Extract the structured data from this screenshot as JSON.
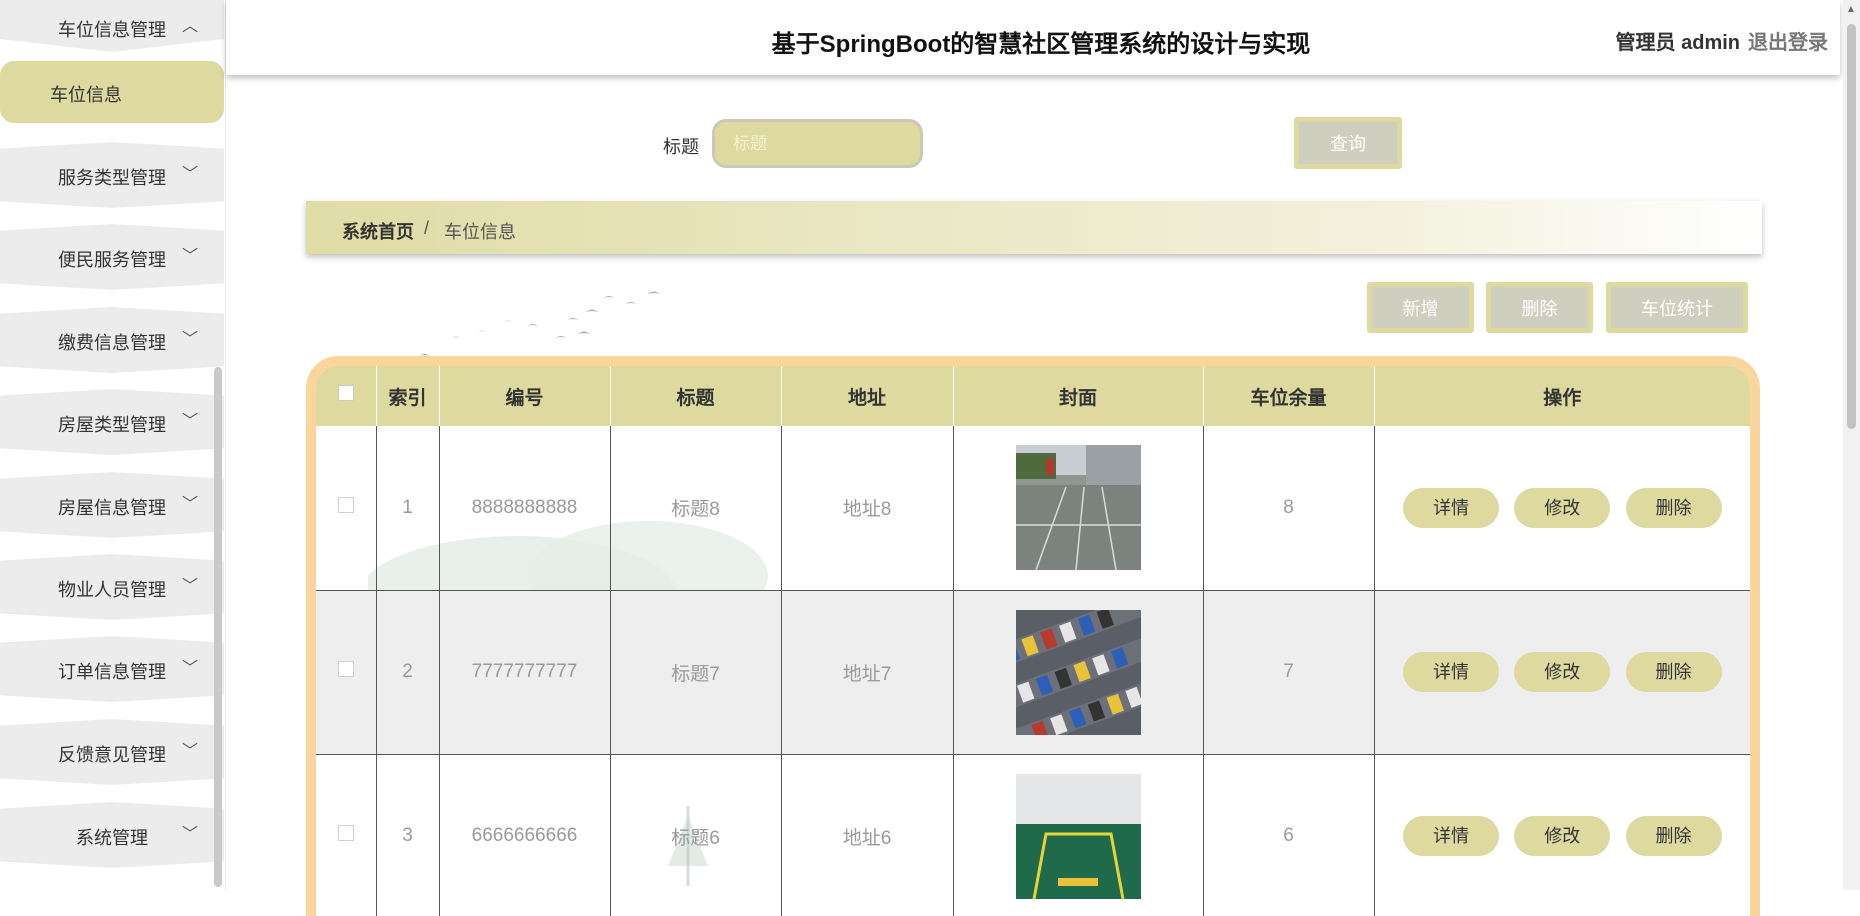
{
  "header": {
    "title": "基于SpringBoot的智慧社区管理系统的设计与实现",
    "user": "管理员 admin",
    "logout": "退出登录"
  },
  "sidebar": {
    "open_group": {
      "label": "车位信息管理",
      "chevron": "chevron-up-icon"
    },
    "active_item": "车位信息",
    "groups": [
      {
        "label": "服务类型管理"
      },
      {
        "label": "便民服务管理"
      },
      {
        "label": "缴费信息管理"
      },
      {
        "label": "房屋类型管理"
      },
      {
        "label": "房屋信息管理"
      },
      {
        "label": "物业人员管理"
      },
      {
        "label": "订单信息管理"
      },
      {
        "label": "反馈意见管理"
      },
      {
        "label": "系统管理"
      }
    ]
  },
  "search": {
    "label": "标题",
    "placeholder": "标题",
    "button": "查询"
  },
  "breadcrumb": {
    "home": "系统首页",
    "separator": "/",
    "current": "车位信息"
  },
  "actions": {
    "add": "新增",
    "delete": "删除",
    "stats": "车位统计"
  },
  "table": {
    "columns": [
      "索引",
      "编号",
      "标题",
      "地址",
      "封面",
      "车位余量",
      "操作"
    ],
    "rows": [
      {
        "index": "1",
        "code": "8888888888",
        "title": "标题8",
        "address": "地址8",
        "cover": "parking-lot-photo",
        "remaining": "8"
      },
      {
        "index": "2",
        "code": "7777777777",
        "title": "标题7",
        "address": "地址7",
        "cover": "aerial-parking-photo",
        "remaining": "7"
      },
      {
        "index": "3",
        "code": "6666666666",
        "title": "标题6",
        "address": "地址6",
        "cover": "garage-parking-photo",
        "remaining": "6"
      }
    ],
    "row_actions": {
      "detail": "详情",
      "edit": "修改",
      "delete": "删除"
    }
  },
  "colors": {
    "accent": "#ddd99f",
    "table_border": "#fbd69c",
    "button_inner": "#cfcfc0"
  }
}
